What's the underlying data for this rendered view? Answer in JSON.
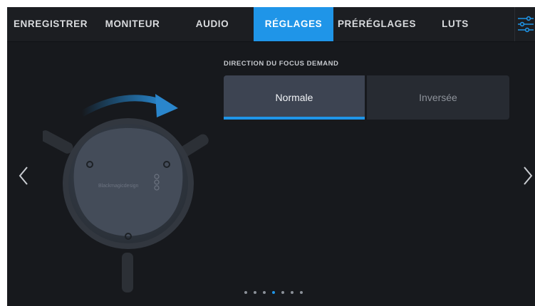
{
  "tabs": [
    {
      "label": "ENREGISTRER",
      "active": false
    },
    {
      "label": "MONITEUR",
      "active": false
    },
    {
      "label": "AUDIO",
      "active": false
    },
    {
      "label": "RÉGLAGES",
      "active": true
    },
    {
      "label": "PRÉRÉGLAGES",
      "active": false
    },
    {
      "label": "LUTS",
      "active": false
    }
  ],
  "menu_icon": "sliders-icon",
  "setting": {
    "label": "DIRECTION DU FOCUS DEMAND",
    "options": [
      "Normale",
      "Inversée"
    ],
    "selected": "Normale"
  },
  "illustration": {
    "brand_text": "Blackmagicdesign",
    "arrow_icon": "curved-arrow-icon"
  },
  "navigation": {
    "prev_icon": "chevron-left-icon",
    "next_icon": "chevron-right-icon"
  },
  "pagination": {
    "total": 7,
    "current": 3
  },
  "colors": {
    "accent": "#1f95e8",
    "background": "#17191d",
    "tabbar": "#1c1e22"
  }
}
